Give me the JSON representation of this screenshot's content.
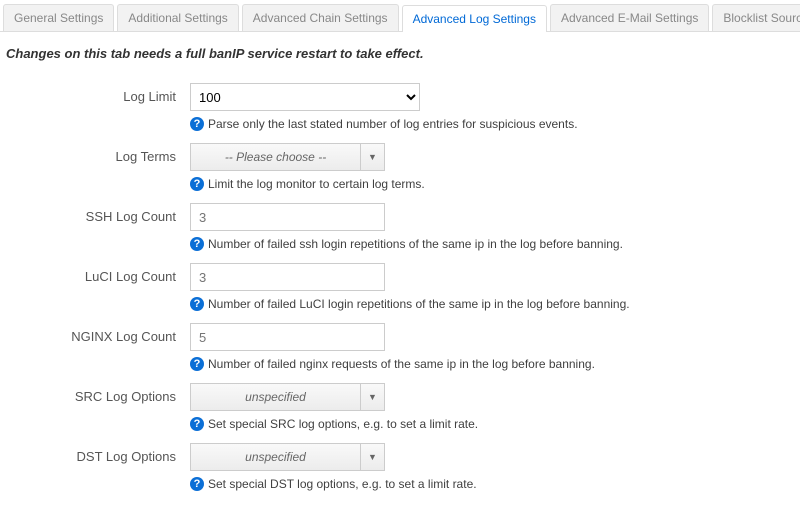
{
  "tabs": {
    "general": "General Settings",
    "additional": "Additional Settings",
    "chain": "Advanced Chain Settings",
    "log": "Advanced Log Settings",
    "email": "Advanced E-Mail Settings",
    "blocklist": "Blocklist Sources"
  },
  "intro": "Changes on this tab needs a full banIP service restart to take effect.",
  "fields": {
    "log_limit": {
      "label": "Log Limit",
      "value": "100",
      "help": "Parse only the last stated number of log entries for suspicious events."
    },
    "log_terms": {
      "label": "Log Terms",
      "placeholder": "-- Please choose --",
      "help": "Limit the log monitor to certain log terms."
    },
    "ssh_count": {
      "label": "SSH Log Count",
      "placeholder": "3",
      "help": "Number of failed ssh login repetitions of the same ip in the log before banning."
    },
    "luci_count": {
      "label": "LuCI Log Count",
      "placeholder": "3",
      "help": "Number of failed LuCI login repetitions of the same ip in the log before banning."
    },
    "nginx_count": {
      "label": "NGINX Log Count",
      "placeholder": "5",
      "help": "Number of failed nginx requests of the same ip in the log before banning."
    },
    "src_opts": {
      "label": "SRC Log Options",
      "placeholder": "unspecified",
      "help": "Set special SRC log options, e.g. to set a limit rate."
    },
    "dst_opts": {
      "label": "DST Log Options",
      "placeholder": "unspecified",
      "help": "Set special DST log options, e.g. to set a limit rate."
    }
  },
  "glyphs": {
    "help": "?",
    "caret": "▼"
  }
}
